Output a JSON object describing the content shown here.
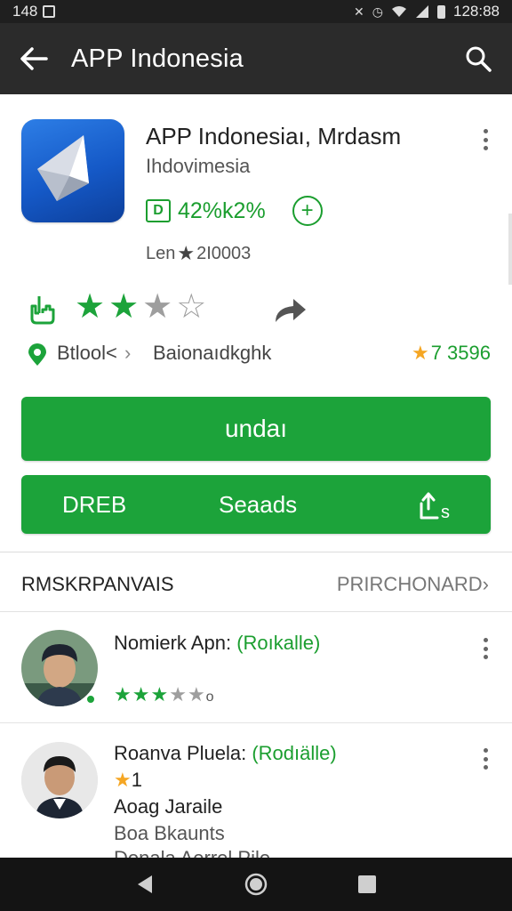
{
  "status_bar": {
    "time": "148",
    "clock": "128:88"
  },
  "app_bar": {
    "title": "APP Indonesia"
  },
  "app": {
    "name": "APP Indonesiaı, Mrdasm",
    "subtitle": "Ihdovimesia",
    "rating_value": "42%k2%",
    "badge_letter": "D",
    "plus": "+",
    "meta_prefix": "Len",
    "meta_count": "2I0003"
  },
  "rating_row": {
    "stars_filled": 2,
    "stars_half": 1,
    "stars_total": 4
  },
  "category": {
    "label": "Btlool<",
    "chevron": "›",
    "label_2": "Baionaıdkghk",
    "stats_star": "★",
    "stats_value": "7 3596"
  },
  "buttons": {
    "install": "undaı",
    "left": "DREB",
    "middle": "Seaads"
  },
  "reviews_header": {
    "title": "RMSKRPANVAIS",
    "link": "PRIRCHONARD›"
  },
  "reviews": [
    {
      "name": "Nomierk Apn:",
      "tag": "(Roıkalle)",
      "rating": 2.5,
      "rating_suffix": "o"
    },
    {
      "name": "Roanva Pluela:",
      "tag": "(Rodıälle)",
      "rating_star": "★",
      "rating_text": "1",
      "line_1": "Aoag Jaraile",
      "line_2": "Boa Bkaunts",
      "line_3": "Donala Aerrel Pile"
    }
  ],
  "colors": {
    "green": "#1ca33a",
    "dark_bar": "#2b2b2b",
    "star_gray": "#9e9e9e",
    "gold": "#f5a623"
  }
}
